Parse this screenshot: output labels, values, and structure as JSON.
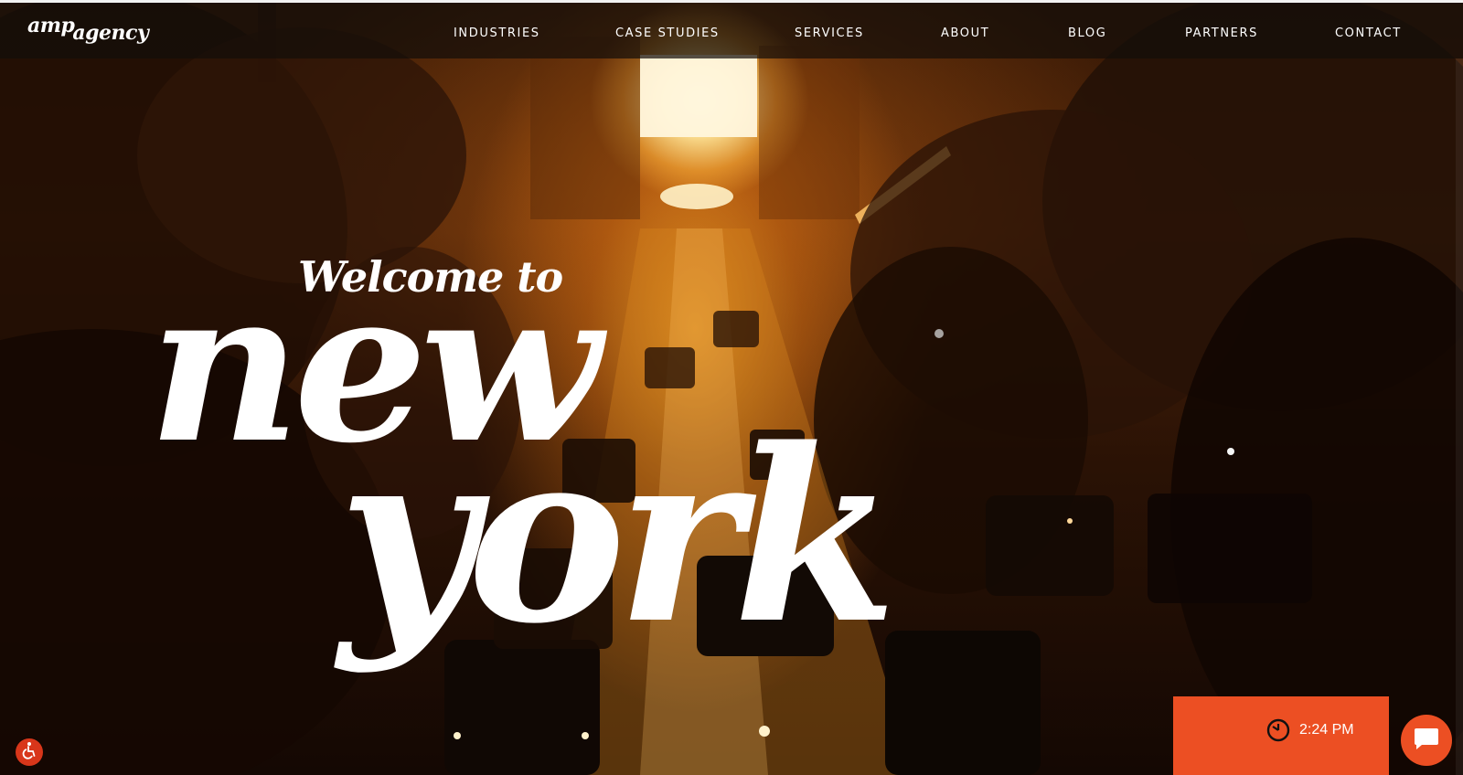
{
  "brand": {
    "logo_line1": "amp",
    "logo_line2": "agency"
  },
  "nav": {
    "items": [
      {
        "label": "INDUSTRIES"
      },
      {
        "label": "CASE STUDIES"
      },
      {
        "label": "SERVICES"
      },
      {
        "label": "ABOUT"
      },
      {
        "label": "BLOG"
      },
      {
        "label": "PARTNERS"
      },
      {
        "label": "CONTACT"
      }
    ]
  },
  "hero": {
    "welcome": "Welcome to",
    "city_line1": "new",
    "city_line2": "york"
  },
  "widgets": {
    "clock_time": "2:24 PM",
    "clock_icon": "clock-icon",
    "chat_icon": "chat-bubble-icon",
    "accessibility_icon": "wheelchair-icon"
  },
  "colors": {
    "accent": "#ec4f23",
    "header_bg": "#140e0a",
    "text": "#ffffff"
  }
}
